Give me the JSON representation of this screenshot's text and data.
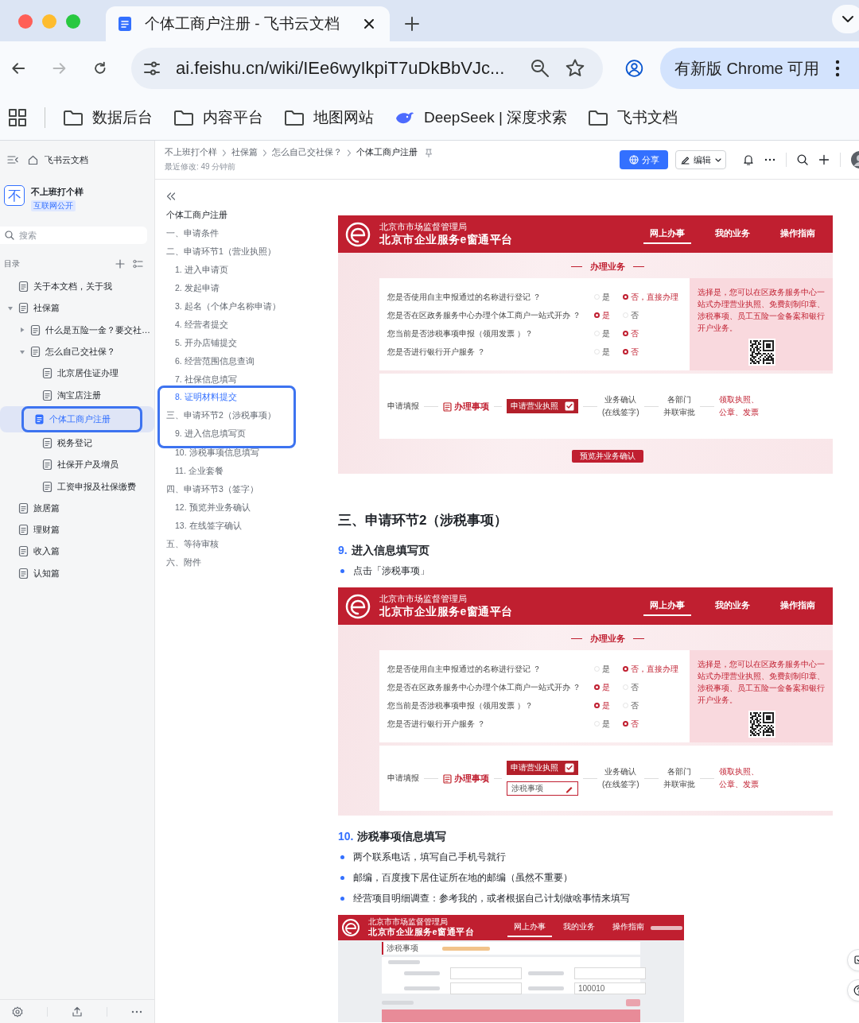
{
  "browser": {
    "tabs": [
      {
        "title": "个体工商户注册 - 飞书云文档",
        "selected": true
      }
    ],
    "url": "ai.feishu.cn/wiki/IEe6wyIkpiT7uDkBbVJc...",
    "update_button": "有新版 Chrome 可用",
    "bookmarks": [
      {
        "label": "数据后台",
        "kind": "folder"
      },
      {
        "label": "内容平台",
        "kind": "folder"
      },
      {
        "label": "地图网站",
        "kind": "folder"
      },
      {
        "label": "DeepSeek | 深度求索",
        "kind": "site"
      },
      {
        "label": "飞书文档",
        "kind": "folder"
      }
    ]
  },
  "sidebar": {
    "home": "飞书云文档",
    "space": {
      "avatar": "不",
      "name": "不上班打个样",
      "badge": "互联网公开"
    },
    "search": {
      "placeholder": "搜索"
    },
    "toc_label": "目录",
    "tree": [
      {
        "label": "关于本文档，关于我",
        "selected": false
      },
      {
        "label": "社保篇",
        "selected": false,
        "expanded": true,
        "children": [
          {
            "label": "什么是五险一金？要交社…",
            "selected": false,
            "expanded": false
          },
          {
            "label": "怎么自己交社保？",
            "selected": false,
            "expanded": true,
            "children": [
              {
                "label": "北京居住证办理",
                "selected": false
              },
              {
                "label": "淘宝店注册",
                "selected": false
              },
              {
                "label": "个体工商户注册",
                "selected": true,
                "circled": true
              },
              {
                "label": "税务登记",
                "selected": false
              },
              {
                "label": "社保开户及增员",
                "selected": false
              },
              {
                "label": "工资申报及社保缴费",
                "selected": false
              }
            ]
          }
        ]
      },
      {
        "label": "旅居篇",
        "selected": false
      },
      {
        "label": "理财篇",
        "selected": false
      },
      {
        "label": "收入篇",
        "selected": false
      },
      {
        "label": "认知篇",
        "selected": false
      }
    ]
  },
  "doc_header": {
    "breadcrumb": [
      "不上班打个样",
      "社保篇",
      "怎么自己交社保？",
      "个体工商户注册"
    ],
    "modified": "最近修改: 49 分钟前",
    "share": "分享",
    "edit": "编辑"
  },
  "outline": {
    "title": "个体工商户注册",
    "items": [
      {
        "label": "一、申请条件",
        "selected": false
      },
      {
        "label": "二、申请环节1（营业执照）",
        "selected": false,
        "children": [
          {
            "label": "1. 进入申请页",
            "selected": false
          },
          {
            "label": "2. 发起申请",
            "selected": false
          },
          {
            "label": "3. 起名（个体户名称申请）",
            "selected": false
          },
          {
            "label": "4. 经营者提交",
            "selected": false
          },
          {
            "label": "5. 开办店铺提交",
            "selected": false
          },
          {
            "label": "6. 经营范围信息查询",
            "selected": false
          },
          {
            "label": "7. 社保信息填写",
            "selected": false
          },
          {
            "label": "8. 证明材料提交",
            "selected": true,
            "circled": true
          }
        ]
      },
      {
        "label": "三、申请环节2（涉税事项）",
        "selected": false,
        "circled": true,
        "children": [
          {
            "label": "9. 进入信息填写页",
            "selected": false,
            "circled": true
          },
          {
            "label": "10. 涉税事项信息填写",
            "selected": false
          },
          {
            "label": "11. 企业套餐",
            "selected": false
          }
        ]
      },
      {
        "label": "四、申请环节3（签字）",
        "selected": false,
        "children": [
          {
            "label": "12. 预览并业务确认",
            "selected": false
          },
          {
            "label": "13. 在线签字确认",
            "selected": false
          }
        ]
      },
      {
        "label": "五、等待审核",
        "selected": false
      },
      {
        "label": "六、附件",
        "selected": false
      }
    ]
  },
  "document": {
    "blocks": [
      {
        "kind": "portal",
        "org": "北京市市场监督管理局",
        "platform": "北京市企业服务e窗通平台",
        "nav": [
          {
            "label": "网上办事",
            "selected": true
          },
          {
            "label": "我的业务",
            "selected": false
          },
          {
            "label": "操作指南",
            "selected": false
          }
        ],
        "section": "办理业务",
        "questions": [
          {
            "text": "您是否使用自主申报通过的名称进行登记 ？",
            "options": [
              {
                "label": "是",
                "selected": false
              },
              {
                "label": "否，直接办理",
                "selected": true
              }
            ]
          },
          {
            "text": "您是否在区政务服务中心办理个体工商户一站式开办 ？",
            "options": [
              {
                "label": "是",
                "selected": true
              },
              {
                "label": "否",
                "selected": false
              }
            ]
          },
          {
            "text": "您当前是否涉税事项申报（领用发票 ）？",
            "options": [
              {
                "label": "是",
                "selected": false
              },
              {
                "label": "否",
                "selected": true
              }
            ]
          },
          {
            "text": "您是否进行银行开户服务 ？",
            "options": [
              {
                "label": "是",
                "selected": false
              },
              {
                "label": "否",
                "selected": true
              }
            ]
          }
        ],
        "note": "选择是，您可以在区政务服务中心一站式办理营业执照、免费刻制印章、涉税事项、员工五险一金备案和银行开户业务。",
        "flow_start": "申请填报",
        "flow_step": "办理事项",
        "flow_items": [
          {
            "label": "申请营业执照",
            "kind": "checked"
          }
        ],
        "flow_steps": [
          {
            "lines": [
              "业务确认",
              "(在线签字)"
            ],
            "kind": "step"
          },
          {
            "lines": [
              "各部门",
              "并联审批"
            ],
            "kind": "step"
          },
          {
            "lines": [
              "领取执照、",
              "公章、发票"
            ],
            "kind": "result"
          }
        ],
        "button": "预览并业务确认"
      },
      {
        "kind": "heading",
        "text": "三、申请环节2（涉税事项）"
      },
      {
        "kind": "numbered_heading",
        "number": "9.",
        "text": "进入信息填写页"
      },
      {
        "kind": "bullet",
        "text": "点击「涉税事项」"
      },
      {
        "kind": "portal",
        "org": "北京市市场监督管理局",
        "platform": "北京市企业服务e窗通平台",
        "nav": [
          {
            "label": "网上办事",
            "selected": true
          },
          {
            "label": "我的业务",
            "selected": false
          },
          {
            "label": "操作指南",
            "selected": false
          }
        ],
        "section": "办理业务",
        "questions": [
          {
            "text": "您是否使用自主申报通过的名称进行登记 ？",
            "options": [
              {
                "label": "是",
                "selected": false
              },
              {
                "label": "否，直接办理",
                "selected": true
              }
            ]
          },
          {
            "text": "您是否在区政务服务中心办理个体工商户一站式开办 ？",
            "options": [
              {
                "label": "是",
                "selected": true
              },
              {
                "label": "否",
                "selected": false
              }
            ]
          },
          {
            "text": "您当前是否涉税事项申报（领用发票 ）？",
            "options": [
              {
                "label": "是",
                "selected": true
              },
              {
                "label": "否",
                "selected": false
              }
            ]
          },
          {
            "text": "您是否进行银行开户服务 ？",
            "options": [
              {
                "label": "是",
                "selected": false
              },
              {
                "label": "否",
                "selected": true
              }
            ]
          }
        ],
        "note": "选择是，您可以在区政务服务中心一站式办理营业执照、免费刻制印章、涉税事项、员工五险一金备案和银行开户业务。",
        "flow_start": "申请填报",
        "flow_step": "办理事项",
        "flow_items": [
          {
            "label": "申请营业执照",
            "kind": "checked"
          },
          {
            "label": "涉税事项",
            "kind": "edit"
          }
        ],
        "flow_steps": [
          {
            "lines": [
              "业务确认",
              "(在线签字)"
            ],
            "kind": "step"
          },
          {
            "lines": [
              "各部门",
              "并联审批"
            ],
            "kind": "step"
          },
          {
            "lines": [
              "领取执照、",
              "公章、发票"
            ],
            "kind": "result"
          }
        ]
      },
      {
        "kind": "numbered_heading",
        "number": "10.",
        "text": "涉税事项信息填写"
      },
      {
        "kind": "bullet",
        "text": "两个联系电话，填写自己手机号就行"
      },
      {
        "kind": "bullet",
        "text": "邮编，百度搜下居住证所在地的邮编（虽然不重要）"
      },
      {
        "kind": "bullet",
        "text": "经营项目明细调查：参考我的，或者根据自己计划做啥事情来填写"
      },
      {
        "kind": "portal_form",
        "org": "北京市市场监督管理局",
        "platform": "北京市企业服务e窗通平台",
        "nav": [
          {
            "label": "网上办事",
            "selected": true
          },
          {
            "label": "我的业务",
            "selected": false
          },
          {
            "label": "操作指南",
            "selected": false
          }
        ],
        "section": "涉税事项",
        "postcode": "100010"
      }
    ]
  }
}
